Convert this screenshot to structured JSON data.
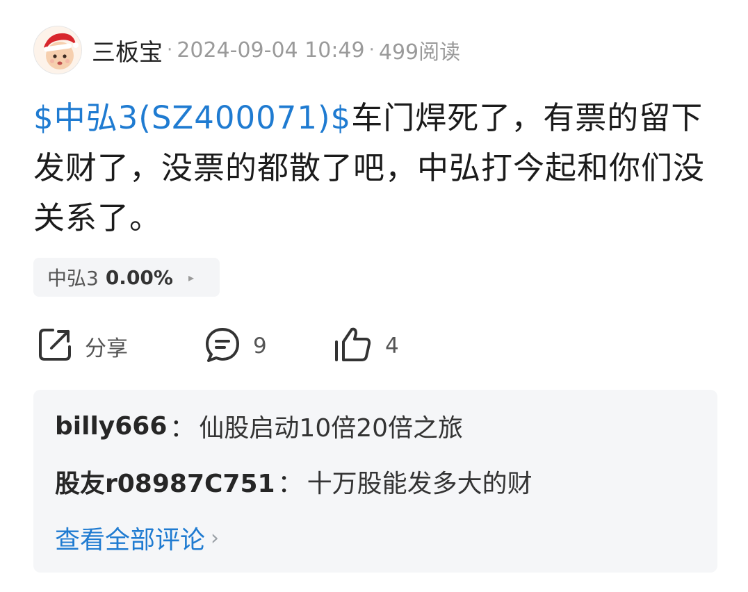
{
  "post": {
    "author": "三板宝",
    "separator": "·",
    "date": "2024-09-04 10:49",
    "reads": "499阅读",
    "stock_link": "$中弘3(SZ400071)$",
    "text": "车门焊死了，有票的留下发财了，没票的都散了吧，中弘打今起和你们没关系了。"
  },
  "stock_chip": {
    "name": "中弘3",
    "change": "0.00%",
    "arrow": "▸"
  },
  "actions": {
    "share_label": "分享",
    "comment_count": "9",
    "like_count": "4"
  },
  "comments": {
    "items": [
      {
        "user": "billy666",
        "colon": "：",
        "text": "仙股启动10倍20倍之旅"
      },
      {
        "user": "股友r08987C751",
        "colon": "：",
        "text": "十万股能发多大的财"
      }
    ],
    "view_all": "查看全部评论",
    "view_all_arrow": "›"
  },
  "colors": {
    "link_blue": "#1f7bd1",
    "text_dark": "#1b1b1b",
    "muted": "#9a9a9a",
    "panel_bg": "#f5f6f8"
  },
  "icons": [
    "avatar-santa-baby",
    "share-icon",
    "comment-icon",
    "thumbs-up-icon",
    "chevron-right-icon"
  ]
}
